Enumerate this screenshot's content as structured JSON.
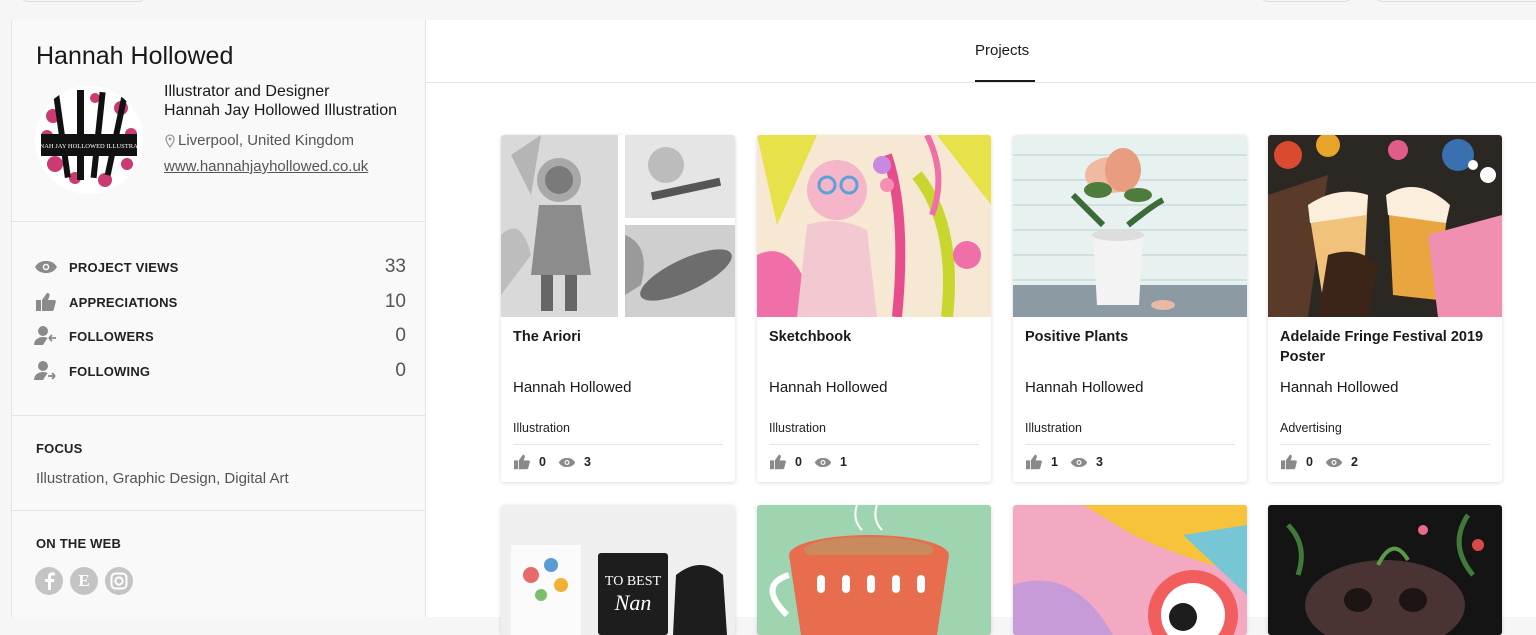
{
  "profile": {
    "name": "Hannah Hollowed",
    "occupation": "Illustrator and Designer",
    "company": "Hannah Jay Hollowed Illustration",
    "location": "Liverpool, United Kingdom",
    "website": "www.hannahjayhollowed.co.uk"
  },
  "stats": [
    {
      "label": "PROJECT VIEWS",
      "value": "33",
      "icon": "eye-icon"
    },
    {
      "label": "APPRECIATIONS",
      "value": "10",
      "icon": "thumbs-up-icon"
    },
    {
      "label": "FOLLOWERS",
      "value": "0",
      "icon": "followers-icon"
    },
    {
      "label": "FOLLOWING",
      "value": "0",
      "icon": "following-icon"
    }
  ],
  "focus": {
    "title": "FOCUS",
    "value": "Illustration, Graphic Design, Digital Art"
  },
  "on_the_web": {
    "title": "ON THE WEB",
    "links": [
      "facebook-icon",
      "etsy-icon",
      "instagram-icon"
    ],
    "etsy_letter": "E"
  },
  "tabs": {
    "projects": "Projects"
  },
  "projects": [
    {
      "title": "The Ariori",
      "owner": "Hannah Hollowed",
      "field": "Illustration",
      "appreciations": "0",
      "views": "3"
    },
    {
      "title": "Sketchbook",
      "owner": "Hannah Hollowed",
      "field": "Illustration",
      "appreciations": "0",
      "views": "1"
    },
    {
      "title": "Positive Plants",
      "owner": "Hannah Hollowed",
      "field": "Illustration",
      "appreciations": "1",
      "views": "3"
    },
    {
      "title": "Adelaide Fringe Festival 2019 Poster",
      "owner": "Hannah Hollowed",
      "field": "Advertising",
      "appreciations": "0",
      "views": "2"
    }
  ],
  "colors": {
    "accent": "#191919",
    "icon_gray": "#8a8a8a",
    "social_gray": "#c4c4c4"
  }
}
